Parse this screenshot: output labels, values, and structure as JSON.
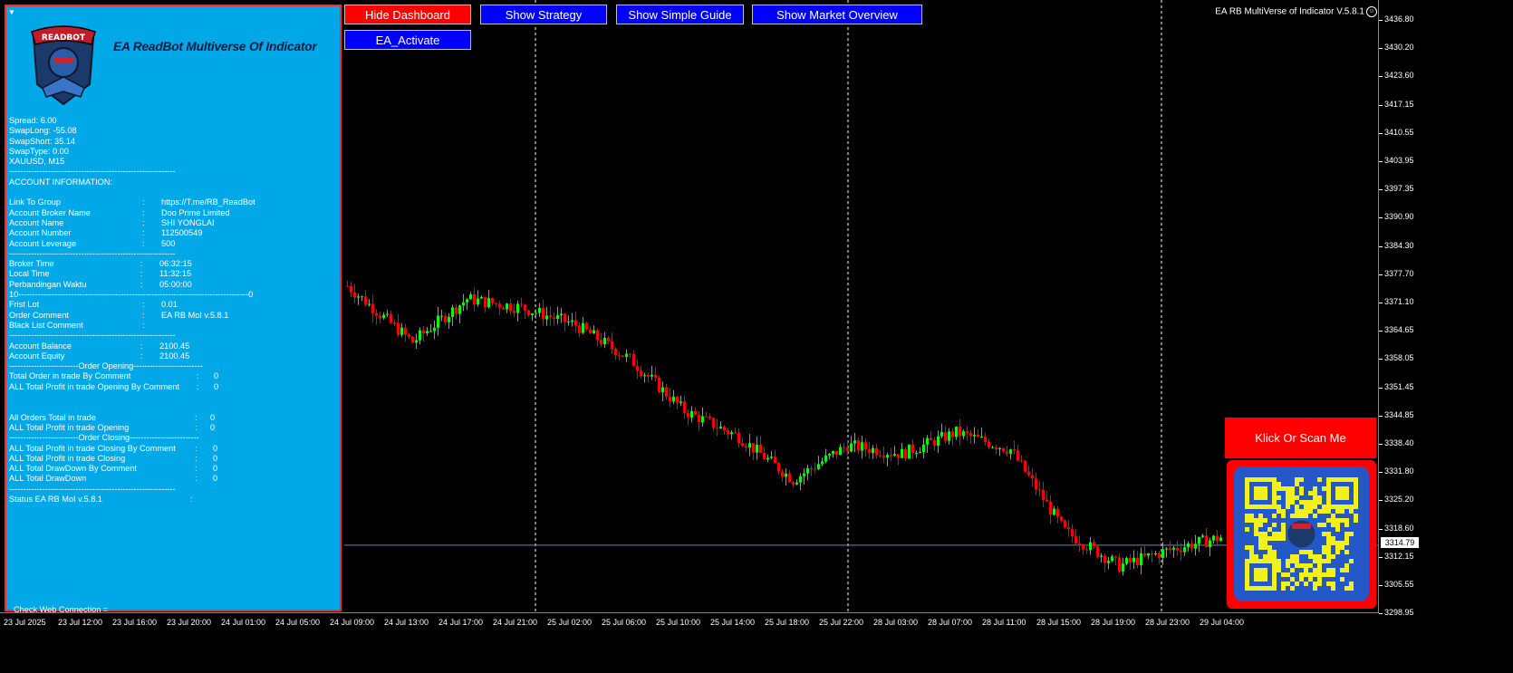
{
  "panel": {
    "title": "EA ReadBot Multiverse Of Indicator",
    "logo_text": "READBOT",
    "collapse_icon": "triangle-down-icon",
    "symbol_info": [
      "Spread: 6.00",
      "SwapLong: -55.08",
      "SwapShort: 35.14",
      "SwapType: 0.00",
      "XAUUSD, M15"
    ],
    "divider_short": "------------------------------------------------------------",
    "account_header": "ACCOUNT INFORMATION:",
    "account_rows": [
      {
        "label": "Link To Group",
        "sep": ":",
        "value": "https://T.me/RB_ReadBot"
      },
      {
        "label": "Account Broker Name",
        "sep": ":",
        "value": "Doo Prime Limited"
      },
      {
        "label": "Account Name",
        "sep": ":",
        "value": "SHI YONGLAI"
      },
      {
        "label": "Account Number",
        "sep": ":",
        "value": "112500549"
      },
      {
        "label": "Account Leverage",
        "sep": ":",
        "value": "500"
      }
    ],
    "time_rows": [
      {
        "label": "Broker Time",
        "sep": ":",
        "value": "06:32:15"
      },
      {
        "label": "Local Time",
        "sep": ":",
        "value": "11:32:15"
      },
      {
        "label": "Perbandingan Waktu",
        "sep": ":",
        "value": "05:00:00"
      }
    ],
    "long_divider": "10-----------------------------------------------------------------------------------0",
    "order_rows": [
      {
        "label": "Frist Lot",
        "sep": ":",
        "value": "0.01"
      },
      {
        "label": "Order Comment",
        "sep": ":",
        "value": "EA RB MoI v.5.8.1"
      },
      {
        "label": "Black List Comment",
        "sep": ":",
        "value": ""
      }
    ],
    "balance_rows": [
      {
        "label": "Account Balance",
        "sep": ":",
        "value": "2100.45"
      },
      {
        "label": "Account Equity",
        "sep": ":",
        "value": "2100.45"
      }
    ],
    "order_opening_header": "-------------------------Order Opening-------------------------",
    "opening_rows": [
      {
        "label": "Total Order in trade By Comment",
        "sep": ":",
        "value": "0"
      },
      {
        "label": "ALL Total Profit in trade Opening By Comment",
        "sep": ":",
        "value": "0"
      }
    ],
    "all_rows": [
      {
        "label": "All Orders Total in trade",
        "sep": ":",
        "value": "0"
      },
      {
        "label": "ALL Total Profit in trade Opening",
        "sep": ":",
        "value": "0"
      }
    ],
    "order_closing_header": "-------------------------Order Closing-------------------------",
    "closing_rows": [
      {
        "label": "ALL Total Profit in trade Closing By Comment",
        "sep": ":",
        "value": "0"
      },
      {
        "label": "ALL Total Profit in trade Closing",
        "sep": ":",
        "value": "0"
      },
      {
        "label": "ALL Total DrawDown By Comment",
        "sep": ":",
        "value": "0"
      },
      {
        "label": "ALL Total DrawDown",
        "sep": ":",
        "value": "0"
      }
    ],
    "status_label": "Status EA RB MoI v.5.8.1",
    "status_sep": ":",
    "web_connection": "Check Web Connection ="
  },
  "buttons": {
    "hide_dashboard": "Hide Dashboard",
    "show_strategy": "Show Strategy",
    "show_simple_guide": "Show Simple Guide",
    "show_market_overview": "Show Market Overview",
    "ea_activate": "EA_Activate"
  },
  "indicator_title": "EA RB MultiVerse of Indicator V.5.8.1",
  "promo": {
    "button": "Klick Or Scan Me",
    "qr_icon": "qr-code-icon"
  },
  "colors": {
    "panel_bg": "#00a8e8",
    "button_red": "#ff0000",
    "button_blue": "#0000ff",
    "bull": "#00ff00",
    "bear": "#ff0000"
  },
  "price_axis": {
    "labels": [
      "3436.80",
      "3430.20",
      "3423.60",
      "3417.15",
      "3410.55",
      "3403.95",
      "3397.35",
      "3390.90",
      "3384.30",
      "3377.70",
      "3371.10",
      "3364.65",
      "3358.05",
      "3351.45",
      "3344.85",
      "3338.40",
      "3331.80",
      "3325.20",
      "3318.60",
      "3312.15",
      "3305.55",
      "3298.95"
    ],
    "current": "3314.79"
  },
  "time_axis": {
    "labels": [
      "23 Jul 2025",
      "23 Jul 12:00",
      "23 Jul 16:00",
      "23 Jul 20:00",
      "24 Jul 01:00",
      "24 Jul 05:00",
      "24 Jul 09:00",
      "24 Jul 13:00",
      "24 Jul 17:00",
      "24 Jul 21:00",
      "25 Jul 02:00",
      "25 Jul 06:00",
      "25 Jul 10:00",
      "25 Jul 14:00",
      "25 Jul 18:00",
      "25 Jul 22:00",
      "28 Jul 03:00",
      "28 Jul 07:00",
      "28 Jul 11:00",
      "28 Jul 15:00",
      "28 Jul 19:00",
      "28 Jul 23:00",
      "29 Jul 04:00"
    ]
  },
  "chart_data": {
    "type": "candlestick",
    "symbol": "XAUUSD",
    "timeframe": "M15",
    "ylim": [
      3298.95,
      3436.8
    ],
    "current_price": 3314.79,
    "close_path": [
      {
        "t": "24 Jul 09:00",
        "close": 3375
      },
      {
        "t": "24 Jul 13:00",
        "close": 3362
      },
      {
        "t": "24 Jul 17:00",
        "close": 3372
      },
      {
        "t": "24 Jul 21:00",
        "close": 3370
      },
      {
        "t": "25 Jul 02:00",
        "close": 3366
      },
      {
        "t": "25 Jul 06:00",
        "close": 3358
      },
      {
        "t": "25 Jul 10:00",
        "close": 3346
      },
      {
        "t": "25 Jul 14:00",
        "close": 3340
      },
      {
        "t": "25 Jul 18:00",
        "close": 3330
      },
      {
        "t": "25 Jul 22:00",
        "close": 3338
      },
      {
        "t": "28 Jul 03:00",
        "close": 3336
      },
      {
        "t": "28 Jul 07:00",
        "close": 3341
      },
      {
        "t": "28 Jul 11:00",
        "close": 3337
      },
      {
        "t": "28 Jul 15:00",
        "close": 3318
      },
      {
        "t": "28 Jul 19:00",
        "close": 3310
      },
      {
        "t": "28 Jul 23:00",
        "close": 3314
      },
      {
        "t": "29 Jul 04:00",
        "close": 3317
      }
    ]
  }
}
